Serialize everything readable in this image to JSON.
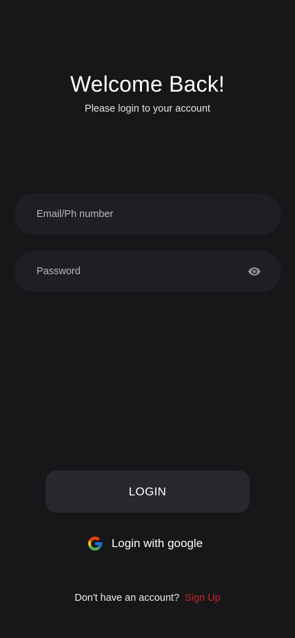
{
  "header": {
    "title": "Welcome Back!",
    "subtitle": "Please login to your account"
  },
  "form": {
    "email": {
      "placeholder": "Email/Ph number",
      "value": ""
    },
    "password": {
      "placeholder": "Password",
      "value": "",
      "toggle_icon": "eye-icon"
    }
  },
  "actions": {
    "login_label": "LOGIN",
    "google_label": "Login with google",
    "google_icon": "google-icon"
  },
  "footer": {
    "prompt": "Don't have an account?",
    "signup_label": "Sign Up"
  },
  "colors": {
    "background": "#17171a",
    "field": "#1e1e23",
    "button": "#28292e",
    "accent": "#c8262a"
  }
}
